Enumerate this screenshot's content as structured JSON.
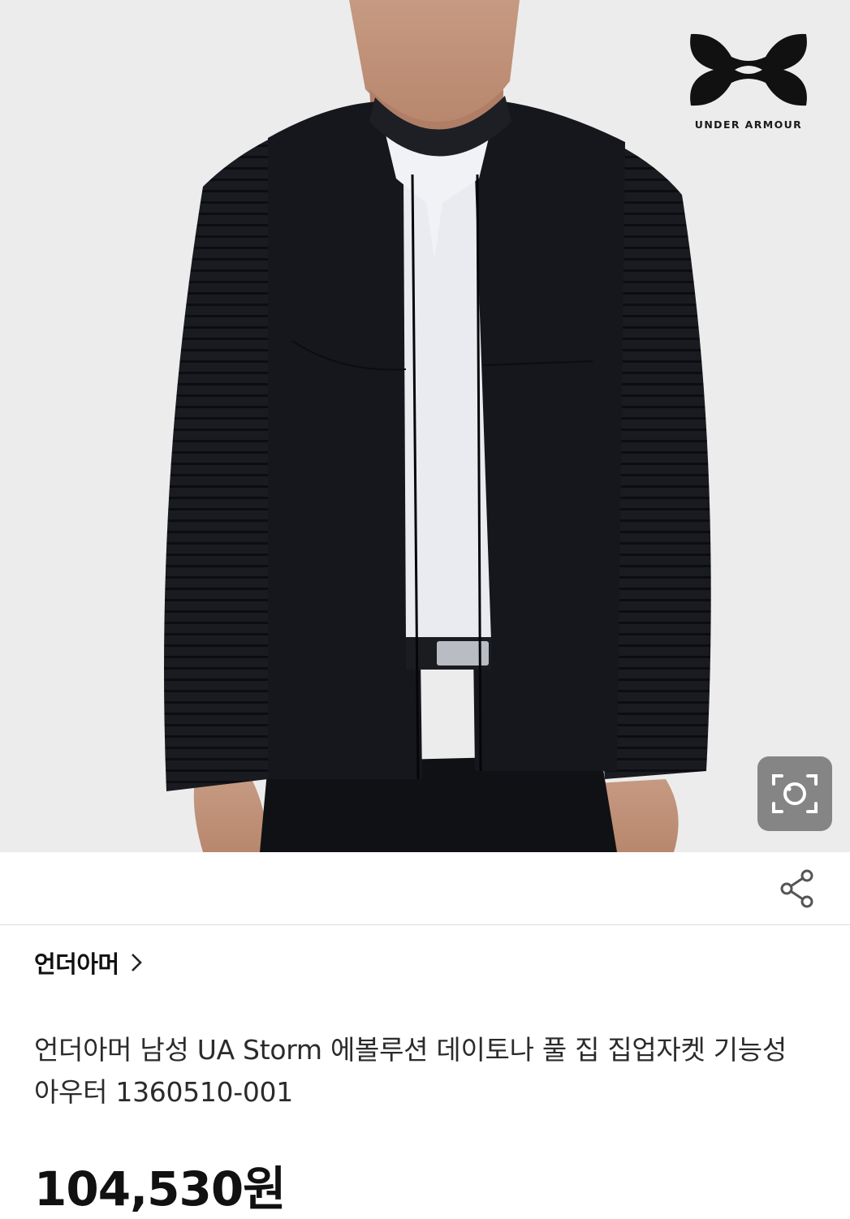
{
  "brand_logo": {
    "text": "UNDER ARMOUR"
  },
  "lens_button": {
    "icon": "camera-search-icon"
  },
  "share_button": {
    "icon": "share-icon"
  },
  "brand_link": {
    "label": "언더아머",
    "icon": "chevron-right-icon"
  },
  "product": {
    "title": "언더아머 남성 UA Storm 에볼루션 데이토나 풀 집 집업자켓 기능성 아우터 1360510-001",
    "price": "104,530원"
  },
  "colors": {
    "background": "#ececec",
    "jacket": "#15171c",
    "text": "#111111"
  }
}
